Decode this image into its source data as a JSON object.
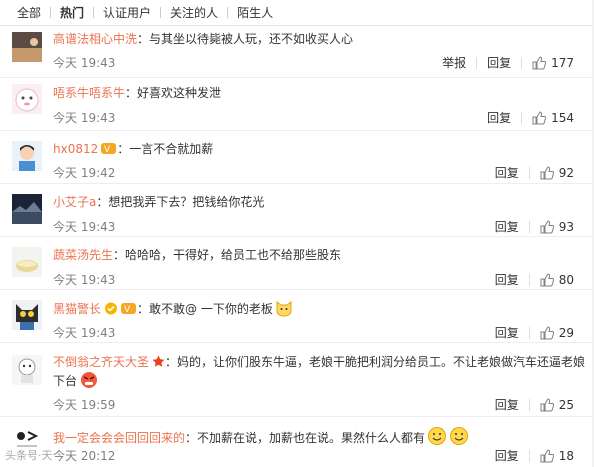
{
  "tabs": [
    {
      "label": "全部",
      "active": false
    },
    {
      "label": "热门",
      "active": true
    },
    {
      "label": "认证用户",
      "active": false
    },
    {
      "label": "关注的人",
      "active": false
    },
    {
      "label": "陌生人",
      "active": false
    }
  ],
  "actions": {
    "report": "举报",
    "reply": "回复"
  },
  "comments": [
    {
      "user": "高谱法相心中洗",
      "text": "：与其坐以待毙被人玩，还不如收买人心",
      "time": "今天 19:43",
      "likes": "177",
      "report": true
    },
    {
      "user": "唔系牛唔系牛",
      "text": "：好喜欢这种发泄",
      "time": "今天 19:43",
      "likes": "154"
    },
    {
      "user": "hx0812",
      "text": "：一言不合就加薪",
      "time": "今天 19:42",
      "likes": "92"
    },
    {
      "user": "小艾子a",
      "text": "：想把我弄下去？把钱给你花光",
      "time": "今天 19:43",
      "likes": "93"
    },
    {
      "user": "蔬菜汤先生",
      "text": "：哈哈哈，干得好，给员工也不给那些股东",
      "time": "今天 19:43",
      "likes": "80"
    },
    {
      "user": "黑猫警长",
      "text": "：敢不敢@ 一下你的老板",
      "time": "今天 19:43",
      "likes": "29"
    },
    {
      "user": "不倒翁之齐天大圣",
      "text": "：妈的，让你们股东牛逼，老娘干脆把利润分给员工。不让老娘做汽车还逼老娘下台",
      "time": "今天 19:59",
      "likes": "25"
    },
    {
      "user": "我一定会会会回回回来的",
      "text": "：不加薪在说，加薪也在说。果然什么人都有",
      "time": "今天 20:12",
      "likes": "18"
    }
  ],
  "watermark": "头条号·天"
}
